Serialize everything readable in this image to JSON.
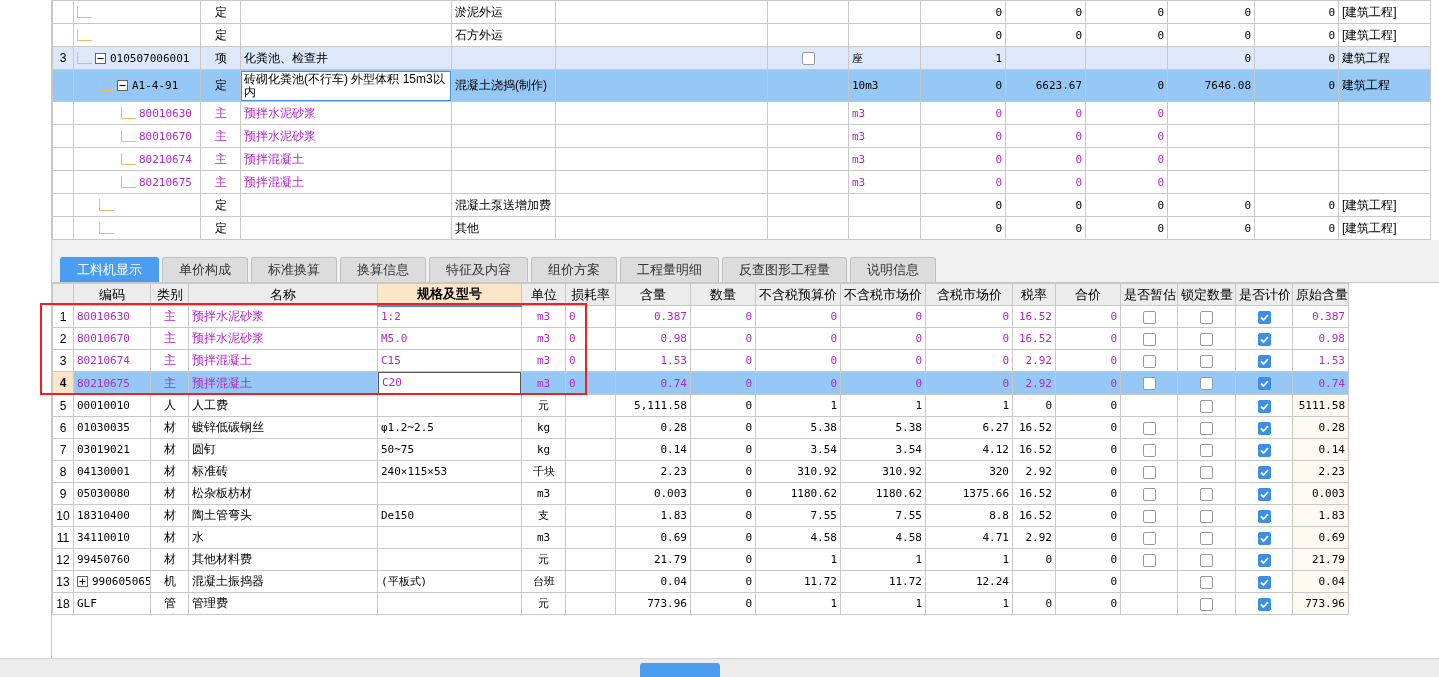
{
  "top_table": {
    "rows": [
      {
        "kind": "quota",
        "selected": false,
        "type": "定",
        "column_5": "淤泥外运",
        "column_9": "0",
        "column_10": "0",
        "column_11": "0",
        "column_12": "0",
        "column_13": "0",
        "column_14": "[建筑工程]"
      },
      {
        "kind": "quota",
        "selected": false,
        "type": "定",
        "column_5": "石方外运",
        "column_9": "0",
        "column_10": "0",
        "column_11": "0",
        "column_12": "0",
        "column_13": "0",
        "column_14": "[建筑工程]"
      },
      {
        "kind": "item",
        "selected": false,
        "row_number": "3",
        "code": "010507006001",
        "type": "项",
        "name": "化粪池、检查井",
        "checkbox": {
          "checked": false
        },
        "unit": "座",
        "column_9": "1",
        "column_12": "0",
        "column_13": "0",
        "column_14": "建筑工程",
        "expanded": true,
        "children": [
          {
            "kind": "quota",
            "selected": true,
            "code": "A1-4-91",
            "type": "定",
            "name": "砖砌化粪池(不行车) 外型体积 15m3以内",
            "column_5": "混凝土浇捣(制作)",
            "unit": "10m3",
            "column_9": "0",
            "column_10": "6623.67",
            "column_11": "0",
            "column_12": "7646.08",
            "column_13": "0",
            "column_14": "建筑工程",
            "expanded": true,
            "children": [
              {
                "kind": "material",
                "selected": false,
                "code": "80010630",
                "type": "主",
                "name": "预拌水泥砂浆",
                "unit": "m3",
                "column_9": "0",
                "column_10": "0",
                "column_11": "0"
              },
              {
                "kind": "material",
                "selected": false,
                "code": "80010670",
                "type": "主",
                "name": "预拌水泥砂浆",
                "unit": "m3",
                "column_9": "0",
                "column_10": "0",
                "column_11": "0"
              },
              {
                "kind": "material",
                "selected": false,
                "code": "80210674",
                "type": "主",
                "name": "预拌混凝土",
                "unit": "m3",
                "column_9": "0",
                "column_10": "0",
                "column_11": "0"
              },
              {
                "kind": "material",
                "selected": false,
                "code": "80210675",
                "type": "主",
                "name": "预拌混凝土",
                "unit": "m3",
                "column_9": "0",
                "column_10": "0",
                "column_11": "0"
              }
            ]
          },
          {
            "kind": "quota",
            "selected": false,
            "type": "定",
            "column_5": "混凝土泵送增加费",
            "column_9": "0",
            "column_10": "0",
            "column_11": "0",
            "column_12": "0",
            "column_13": "0",
            "column_14": "[建筑工程]"
          },
          {
            "kind": "quota",
            "selected": false,
            "type": "定",
            "column_5": "其他",
            "column_9": "0",
            "column_10": "0",
            "column_11": "0",
            "column_12": "0",
            "column_13": "0",
            "column_14": "[建筑工程]"
          }
        ]
      }
    ]
  },
  "tabs": [
    {
      "label": "工料机显示",
      "selected": true
    },
    {
      "label": "单价构成",
      "selected": false
    },
    {
      "label": "标准换算",
      "selected": false
    },
    {
      "label": "换算信息",
      "selected": false
    },
    {
      "label": "特征及内容",
      "selected": false
    },
    {
      "label": "组价方案",
      "selected": false
    },
    {
      "label": "工程量明细",
      "selected": false
    },
    {
      "label": "反查图形工程量",
      "selected": false
    },
    {
      "label": "说明信息",
      "selected": false
    }
  ],
  "resource_table": {
    "columns": [
      {
        "label": "编码",
        "selected": false
      },
      {
        "label": "类别",
        "selected": false
      },
      {
        "label": "名称",
        "selected": false
      },
      {
        "label": "规格及型号",
        "selected": true
      },
      {
        "label": "单位",
        "selected": false
      },
      {
        "label": "损耗率",
        "selected": false
      },
      {
        "label": "含量",
        "selected": false
      },
      {
        "label": "数量",
        "selected": false
      },
      {
        "label": "不含税预算价",
        "selected": false
      },
      {
        "label": "不含税市场价",
        "selected": false
      },
      {
        "label": "含税市场价",
        "selected": false
      },
      {
        "label": "税率",
        "selected": false
      },
      {
        "label": "合价",
        "selected": false
      },
      {
        "label": "是否暂估",
        "selected": false
      },
      {
        "label": "锁定数量",
        "selected": false
      },
      {
        "label": "是否计价",
        "selected": false
      },
      {
        "label": "原始含量",
        "selected": false
      }
    ],
    "rows": [
      {
        "kind": "material",
        "selected": false,
        "row_number": "1",
        "code": "80010630",
        "type": "主",
        "name": "预拌水泥砂浆",
        "spec": "1:2",
        "unit": "m3",
        "loss": "0",
        "content": "0.387",
        "quantity": "0",
        "budget_price": "0",
        "market_price": "0",
        "tax_market_price": "0",
        "tax_rate": "16.52",
        "total": "0",
        "provisional": false,
        "locked": false,
        "priced": true,
        "original_content": "0.387"
      },
      {
        "kind": "material",
        "selected": false,
        "row_number": "2",
        "code": "80010670",
        "type": "主",
        "name": "预拌水泥砂浆",
        "spec": "M5.0",
        "unit": "m3",
        "loss": "0",
        "content": "0.98",
        "quantity": "0",
        "budget_price": "0",
        "market_price": "0",
        "tax_market_price": "0",
        "tax_rate": "16.52",
        "total": "0",
        "provisional": false,
        "locked": false,
        "priced": true,
        "original_content": "0.98"
      },
      {
        "kind": "material",
        "selected": false,
        "row_number": "3",
        "code": "80210674",
        "type": "主",
        "name": "预拌混凝土",
        "spec": "C15",
        "unit": "m3",
        "loss": "0",
        "content": "1.53",
        "quantity": "0",
        "budget_price": "0",
        "market_price": "0",
        "tax_market_price": "0",
        "tax_rate": "2.92",
        "total": "0",
        "provisional": false,
        "locked": false,
        "priced": true,
        "original_content": "1.53"
      },
      {
        "kind": "material",
        "selected": true,
        "row_number": "4",
        "code": "80210675",
        "type": "主",
        "name": "预拌混凝土",
        "spec": "C20",
        "unit": "m3",
        "loss": "0",
        "content": "0.74",
        "quantity": "0",
        "budget_price": "0",
        "market_price": "0",
        "tax_market_price": "0",
        "tax_rate": "2.92",
        "total": "0",
        "provisional": false,
        "locked": false,
        "priced": true,
        "original_content": "0.74"
      },
      {
        "kind": "other",
        "selected": false,
        "row_number": "5",
        "code": "00010010",
        "type": "人",
        "name": "人工费",
        "unit": "元",
        "content": "5,111.58",
        "quantity": "0",
        "budget_price": "1",
        "market_price": "1",
        "tax_market_price": "1",
        "tax_rate": "0",
        "total": "0",
        "locked": false,
        "priced": true,
        "original_content": "5111.58"
      },
      {
        "kind": "other",
        "selected": false,
        "row_number": "6",
        "code": "01030035",
        "type": "材",
        "name": "镀锌低碳钢丝",
        "spec": "φ1.2~2.5",
        "unit": "kg",
        "content": "0.28",
        "quantity": "0",
        "budget_price": "5.38",
        "market_price": "5.38",
        "tax_market_price": "6.27",
        "tax_rate": "16.52",
        "total": "0",
        "provisional": false,
        "locked": false,
        "priced": true,
        "original_content": "0.28"
      },
      {
        "kind": "other",
        "selected": false,
        "row_number": "7",
        "code": "03019021",
        "type": "材",
        "name": "圆钉",
        "spec": "50~75",
        "unit": "kg",
        "content": "0.14",
        "quantity": "0",
        "budget_price": "3.54",
        "market_price": "3.54",
        "tax_market_price": "4.12",
        "tax_rate": "16.52",
        "total": "0",
        "provisional": false,
        "locked": false,
        "priced": true,
        "original_content": "0.14"
      },
      {
        "kind": "other",
        "selected": false,
        "row_number": "8",
        "code": "04130001",
        "type": "材",
        "name": "标准砖",
        "spec": "240×115×53",
        "unit": "千块",
        "content": "2.23",
        "quantity": "0",
        "budget_price": "310.92",
        "market_price": "310.92",
        "tax_market_price": "320",
        "tax_rate": "2.92",
        "total": "0",
        "provisional": false,
        "locked": false,
        "priced": true,
        "original_content": "2.23"
      },
      {
        "kind": "other",
        "selected": false,
        "row_number": "9",
        "code": "05030080",
        "type": "材",
        "name": "松杂板枋材",
        "unit": "m3",
        "content": "0.003",
        "quantity": "0",
        "budget_price": "1180.62",
        "market_price": "1180.62",
        "tax_market_price": "1375.66",
        "tax_rate": "16.52",
        "total": "0",
        "provisional": false,
        "locked": false,
        "priced": true,
        "original_content": "0.003"
      },
      {
        "kind": "other",
        "selected": false,
        "row_number": "10",
        "code": "18310400",
        "type": "材",
        "name": "陶土管弯头",
        "spec": "De150",
        "unit": "支",
        "content": "1.83",
        "quantity": "0",
        "budget_price": "7.55",
        "market_price": "7.55",
        "tax_market_price": "8.8",
        "tax_rate": "16.52",
        "total": "0",
        "provisional": false,
        "locked": false,
        "priced": true,
        "original_content": "1.83"
      },
      {
        "kind": "other",
        "selected": false,
        "row_number": "11",
        "code": "34110010",
        "type": "材",
        "name": "水",
        "unit": "m3",
        "content": "0.69",
        "quantity": "0",
        "budget_price": "4.58",
        "market_price": "4.58",
        "tax_market_price": "4.71",
        "tax_rate": "2.92",
        "total": "0",
        "provisional": false,
        "locked": false,
        "priced": true,
        "original_content": "0.69"
      },
      {
        "kind": "other",
        "selected": false,
        "row_number": "12",
        "code": "99450760",
        "type": "材",
        "name": "其他材料费",
        "unit": "元",
        "content": "21.79",
        "quantity": "0",
        "budget_price": "1",
        "market_price": "1",
        "tax_market_price": "1",
        "tax_rate": "0",
        "total": "0",
        "provisional": false,
        "locked": false,
        "priced": true,
        "original_content": "21.79"
      },
      {
        "kind": "other",
        "selected": false,
        "row_number": "13",
        "code": "990605065",
        "expanded": false,
        "type": "机",
        "name": "混凝土振捣器",
        "spec": "(平板式)",
        "unit": "台班",
        "content": "0.04",
        "quantity": "0",
        "budget_price": "11.72",
        "market_price": "11.72",
        "tax_market_price": "12.24",
        "total": "0",
        "locked": false,
        "priced": true,
        "original_content": "0.04"
      },
      {
        "kind": "other",
        "selected": false,
        "row_number": "18",
        "code": "GLF",
        "type": "管",
        "name": "管理费",
        "unit": "元",
        "content": "773.96",
        "quantity": "0",
        "budget_price": "1",
        "market_price": "1",
        "tax_market_price": "1",
        "tax_rate": "0",
        "total": "0",
        "locked": false,
        "priced": true,
        "original_content": "773.96"
      }
    ]
  }
}
